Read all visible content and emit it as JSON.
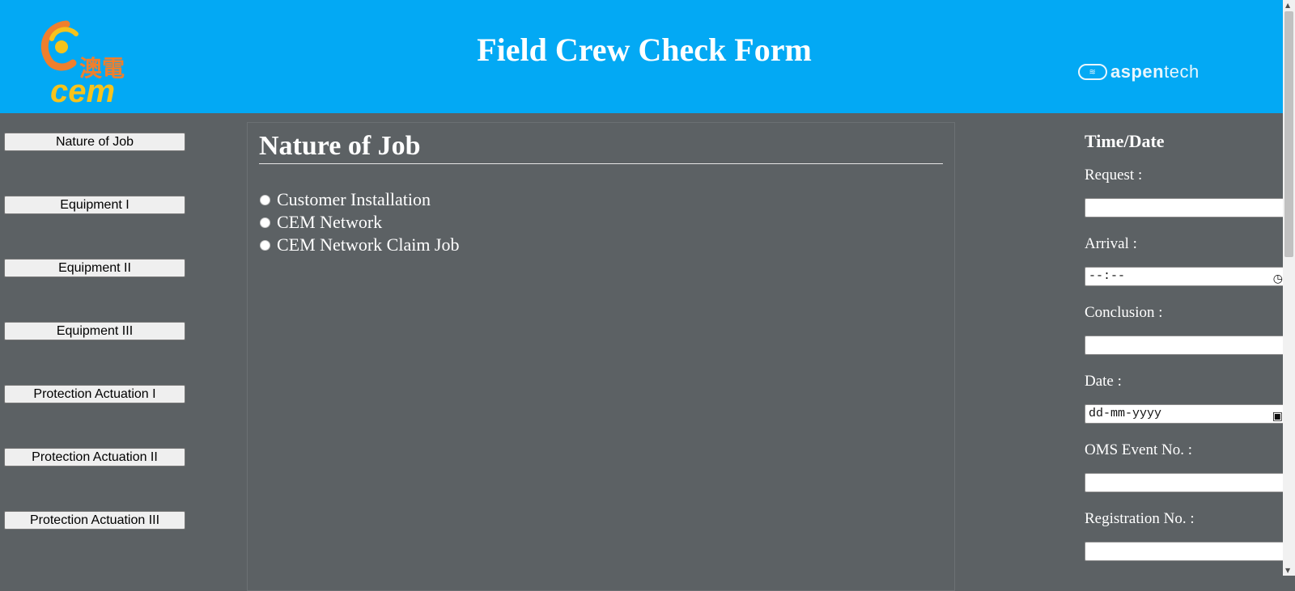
{
  "header": {
    "title": "Field Crew Check Form",
    "left_logo": {
      "chinese": "澳電",
      "latin": "cem"
    },
    "right_logo": {
      "prefix": "aspen",
      "suffix": "tech"
    }
  },
  "sidebar": {
    "items": [
      {
        "label": "Nature of Job"
      },
      {
        "label": "Equipment I"
      },
      {
        "label": "Equipment II"
      },
      {
        "label": "Equipment III"
      },
      {
        "label": "Protection Actuation I"
      },
      {
        "label": "Protection Actuation II"
      },
      {
        "label": "Protection Actuation III"
      }
    ]
  },
  "main": {
    "heading": "Nature of Job",
    "options": [
      {
        "label": "Customer Installation"
      },
      {
        "label": "CEM Network"
      },
      {
        "label": "CEM Network Claim Job"
      }
    ]
  },
  "right_panel": {
    "heading": "Time/Date",
    "fields": [
      {
        "label": "Request :",
        "value": ""
      },
      {
        "label": "Arrival :",
        "value": "--:--"
      },
      {
        "label": "Conclusion :",
        "value": ""
      },
      {
        "label": "Date :",
        "value": "dd-mm-yyyy"
      },
      {
        "label": "OMS Event No. :",
        "value": ""
      },
      {
        "label": "Registration No. :",
        "value": ""
      }
    ]
  },
  "colors": {
    "header_bg": "#03a9f4",
    "page_bg": "#5c6164",
    "logo_orange": "#f07f2d",
    "logo_yellow": "#f6c31c"
  },
  "icons": {
    "time": "clock-icon",
    "date": "calendar-icon",
    "radio": "radio-unchecked-icon"
  }
}
